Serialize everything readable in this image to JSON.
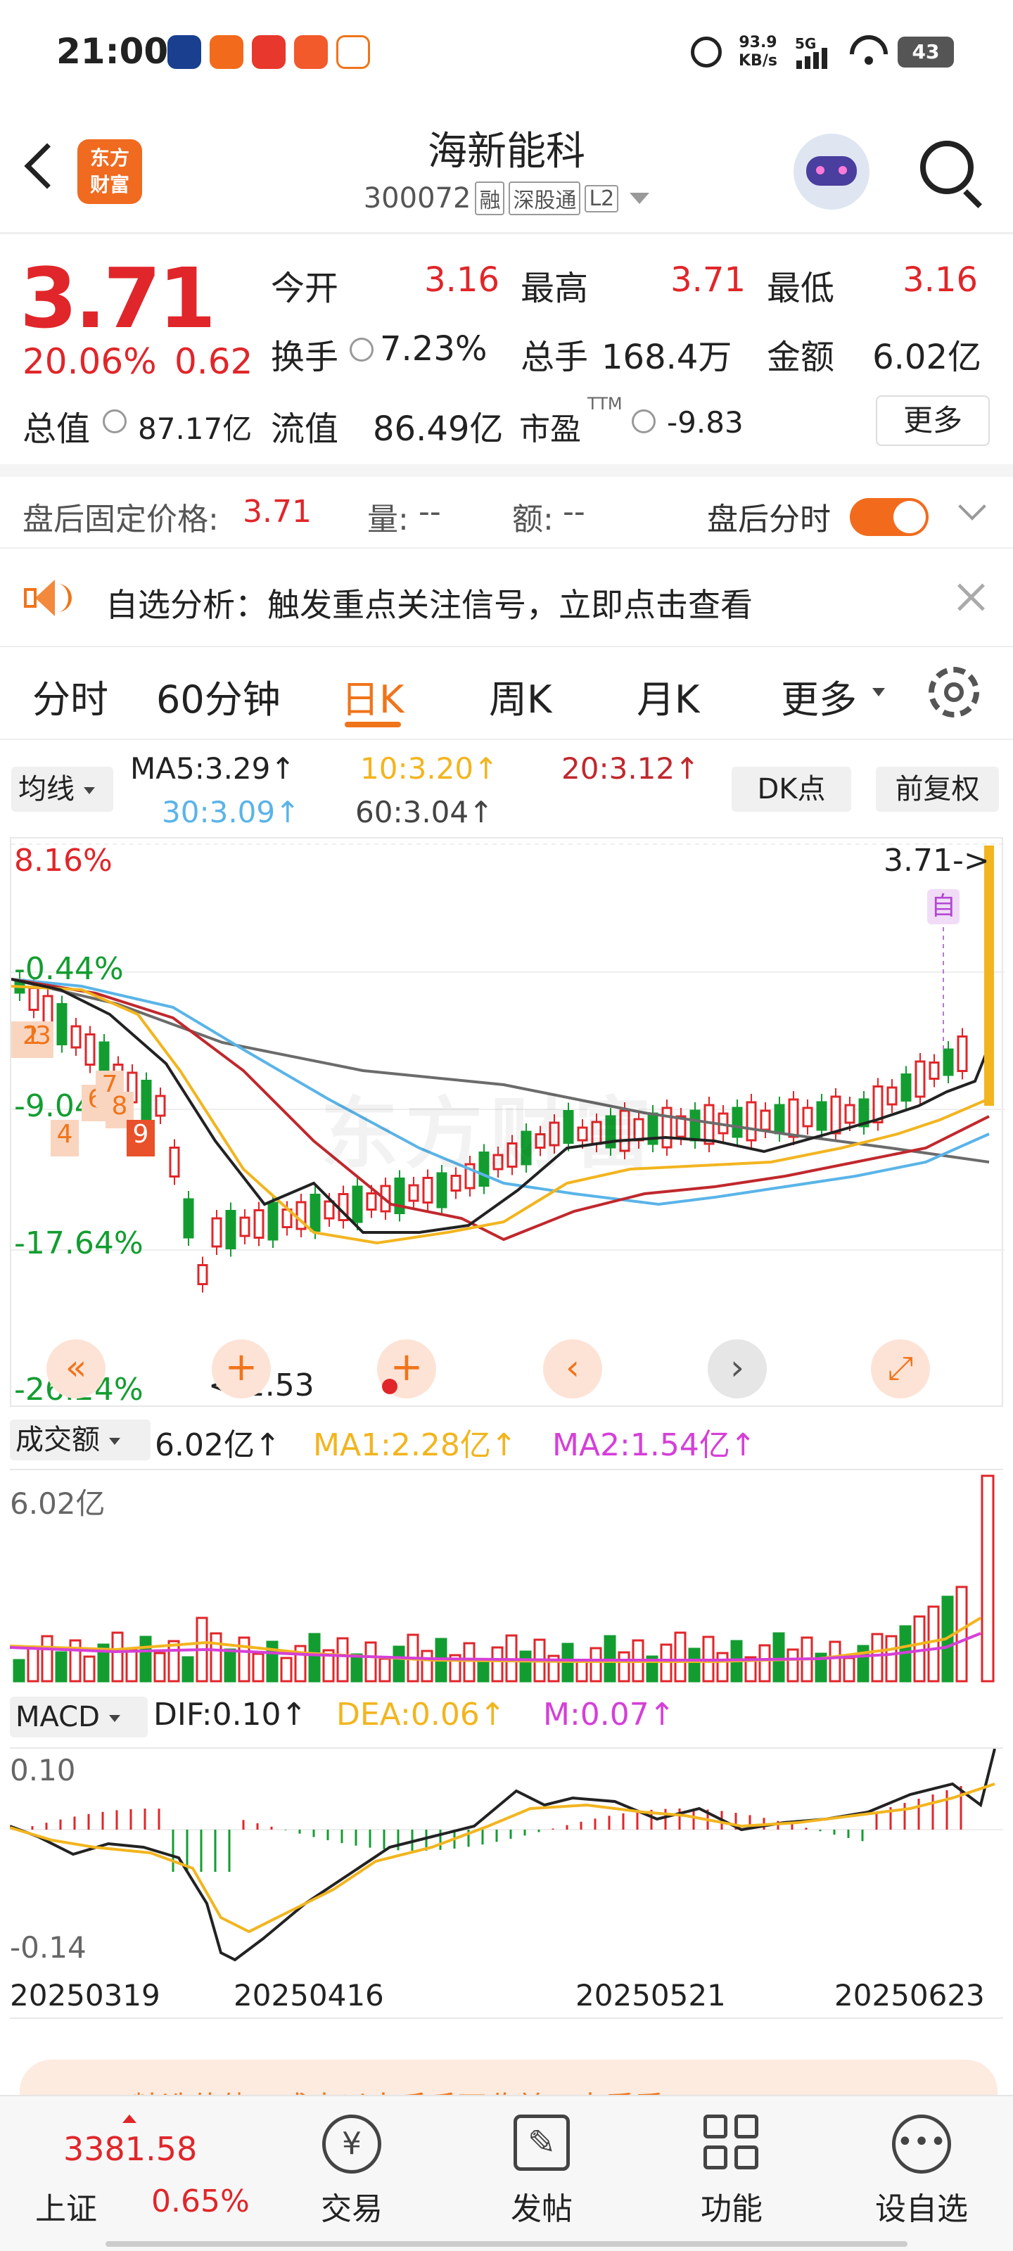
{
  "status_bar": {
    "time": "21:00",
    "net_speed": "93.9",
    "net_unit": "KB/s",
    "signal": "5G",
    "battery": "43"
  },
  "header": {
    "logo_line1": "东方",
    "logo_line2": "财富",
    "stock_name": "海新能科",
    "stock_code": "300072",
    "tags": [
      "融",
      "深股通",
      "L2"
    ]
  },
  "quote": {
    "price": "3.71",
    "change_pct": "20.06%",
    "change": "0.62",
    "open_label": "今开",
    "open": "3.16",
    "high_label": "最高",
    "high": "3.71",
    "low_label": "最低",
    "low": "3.16",
    "turnover_label": "换手",
    "turnover": "7.23%",
    "volume_label": "总手",
    "volume": "168.4万",
    "amount_label": "金额",
    "amount": "6.02亿",
    "mktcap_label": "总值",
    "mktcap": "87.17亿",
    "float_label": "流值",
    "float": "86.49亿",
    "pe_label": "市盈",
    "pe_sup": "TTM",
    "pe": "-9.83",
    "more": "更多"
  },
  "after_hours": {
    "price_label": "盘后固定价格:",
    "price": "3.71",
    "vol_label": "量:",
    "vol": "--",
    "amt_label": "额:",
    "amt": "--",
    "toggle_label": "盘后分时",
    "toggle_on": true
  },
  "notice": {
    "text": "自选分析：触发重点关注信号，立即点击查看"
  },
  "tabs": [
    {
      "label": "分时"
    },
    {
      "label": "60分钟"
    },
    {
      "label": "日K",
      "active": true
    },
    {
      "label": "周K"
    },
    {
      "label": "月K"
    },
    {
      "label": "更多"
    }
  ],
  "ma_legend": {
    "selector": "均线",
    "ma5": "MA5:3.29",
    "ma10": "10:3.20",
    "ma20": "20:3.12",
    "ma30": "30:3.09",
    "ma60": "60:3.04",
    "dk": "DK点",
    "adjust": "前复权"
  },
  "kchart": {
    "top_pct": "8.16%",
    "pct2": "-0.44%",
    "pct3": "-9.04%",
    "pct4": "-17.64%",
    "pct5": "-26.24%",
    "last_price_label": "3.71->",
    "low_label": "<-2.53",
    "self_tag": "自",
    "watermark": "东方财富",
    "markers": [
      "1",
      "2",
      "3",
      "4",
      "6",
      "7",
      "8",
      "9"
    ]
  },
  "volume_panel": {
    "selector": "成交额",
    "value": "6.02亿",
    "ma1": "MA1:2.28亿",
    "ma2": "MA2:1.54亿",
    "axis_max": "6.02亿"
  },
  "macd_panel": {
    "selector": "MACD",
    "dif": "DIF:0.10",
    "dea": "DEA:0.06",
    "m": "M:0.07",
    "axis_top": "0.10",
    "axis_bottom": "-0.14"
  },
  "dates": [
    "20250319",
    "20250416",
    "20250521",
    "20250623"
  ],
  "promo": {
    "text": "精选佳债，成本以来手手不收益！去看看"
  },
  "bottom_nav": {
    "index_value": "3381.58",
    "index_name": "上证",
    "index_pct": "0.65%",
    "items": [
      {
        "label": "交易"
      },
      {
        "label": "发帖"
      },
      {
        "label": "功能"
      },
      {
        "label": "设自选"
      }
    ]
  },
  "colors": {
    "up": "#e0262a",
    "down": "#139d31",
    "accent": "#f0741a",
    "ma5": "#222222",
    "ma10": "#f2b51f",
    "ma20": "#c0282d",
    "ma30": "#5ab4e8",
    "ma60": "#555555"
  }
}
